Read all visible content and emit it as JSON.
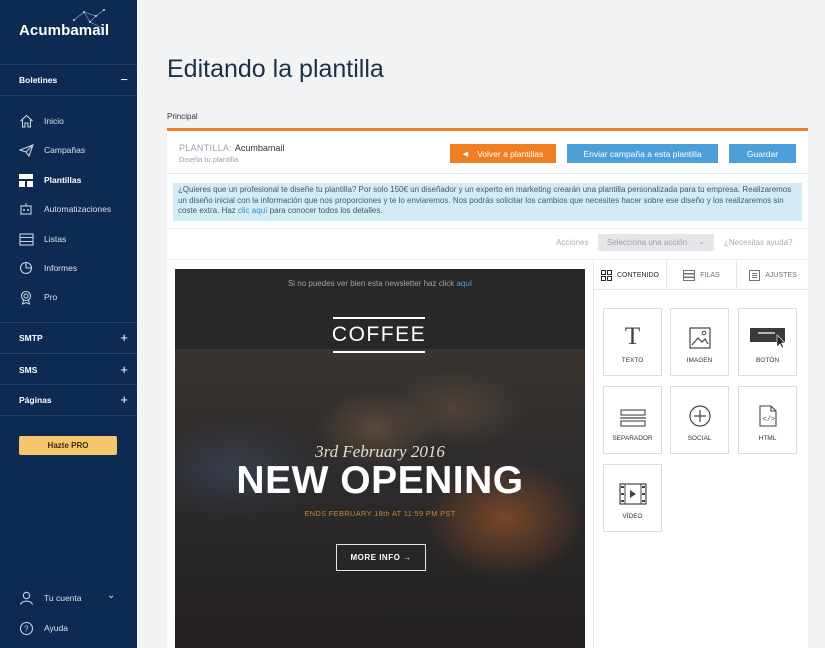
{
  "app": {
    "logo": "Acumbamail"
  },
  "sidebar": {
    "sections": [
      {
        "label": "Boletines",
        "toggle": "−"
      },
      {
        "label": "SMTP",
        "toggle": "+"
      },
      {
        "label": "SMS",
        "toggle": "+"
      },
      {
        "label": "Páginas",
        "toggle": "+"
      }
    ],
    "items": [
      {
        "label": "Inicio",
        "icon": "home-icon"
      },
      {
        "label": "Campañas",
        "icon": "paper-plane-icon"
      },
      {
        "label": "Plantillas",
        "icon": "grid-icon",
        "active": true
      },
      {
        "label": "Automatizaciones",
        "icon": "robot-icon"
      },
      {
        "label": "Listas",
        "icon": "list-icon"
      },
      {
        "label": "Informes",
        "icon": "pie-chart-icon"
      },
      {
        "label": "Pro",
        "icon": "badge-icon"
      }
    ],
    "pro_button": "Hazte PRO",
    "account": {
      "label": "Tu cuenta",
      "chevron": "⌄"
    },
    "help": "Ayuda"
  },
  "page": {
    "title": "Editando la plantilla",
    "tab": "Principal"
  },
  "editor": {
    "template_label": "PLANTILLA:",
    "template_name": "Acumbamail",
    "template_sub": "Diseña tu plantilla",
    "buttons": {
      "volver": "Volver a plantillas",
      "volver_arrow": "◀",
      "enviar": "Enviar campaña a esta plantilla",
      "guardar": "Guardar"
    },
    "info": {
      "text1": "¿Quieres que un profesional te diseñe tu plantilla? Por solo 150€ un diseñador y un experto en marketing crearán una plantilla personalizada para tu empresa. Realizaremos un diseño inicial con la información que nos proporciones y te lo enviaremos. Nos podrás solicitar los cambios que necesites hacer sobre ese diseño y los realizaremos sin coste extra. Haz ",
      "link": "clic aquí",
      "text2": " para conocer todos los detalles."
    },
    "actions": {
      "label": "Acciones",
      "select": "Selecciona una acción",
      "help": "¿Necesitas ayuda?"
    }
  },
  "preview": {
    "top_text": "Si no puedes ver bien esta newsletter haz click ",
    "top_link": "aquí",
    "logo": "COFFEE",
    "date": "3rd February 2016",
    "headline": "NEW OPENING",
    "ends": "ENDS FEBRUARY 18th AT 11:59 PM PST",
    "button": "MORE INFO →"
  },
  "panel": {
    "tabs": [
      "CONTENIDO",
      "FILAS",
      "AJUSTES"
    ],
    "blocks": [
      "TEXTO",
      "IMAGEN",
      "BOTÓN",
      "SEPARADOR",
      "SOCIAL",
      "HTML",
      "VÍDEO"
    ]
  }
}
